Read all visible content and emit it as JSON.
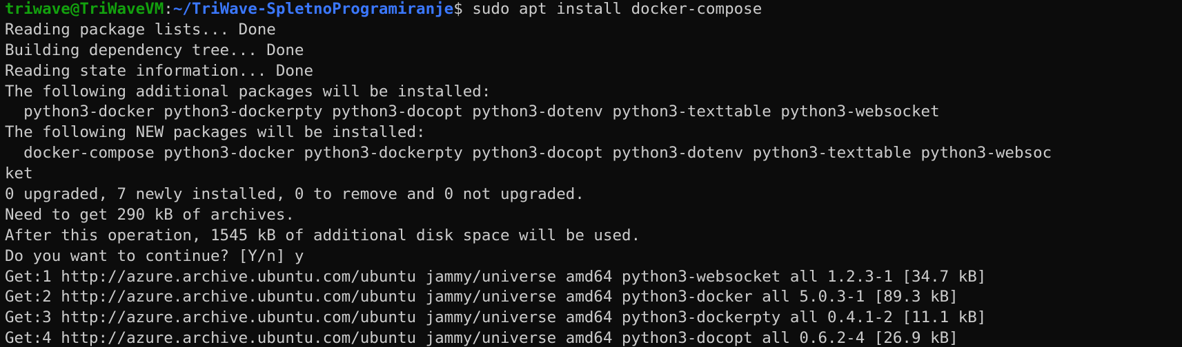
{
  "prompt": {
    "user_host": "triwave@TriWaveVM",
    "separator": ":",
    "path": "~/TriWave-SpletnoProgramiranje",
    "symbol": "$",
    "command": " sudo apt install docker-compose"
  },
  "colors": {
    "background": "#0c0c0c",
    "foreground": "#cccccc",
    "user_host": "#13a10e",
    "path": "#3b78ff"
  },
  "output": [
    "Reading package lists... Done",
    "Building dependency tree... Done",
    "Reading state information... Done",
    "The following additional packages will be installed:",
    "  python3-docker python3-dockerpty python3-docopt python3-dotenv python3-texttable python3-websocket",
    "The following NEW packages will be installed:",
    "  docker-compose python3-docker python3-dockerpty python3-docopt python3-dotenv python3-texttable python3-websoc",
    "ket",
    "0 upgraded, 7 newly installed, 0 to remove and 0 not upgraded.",
    "Need to get 290 kB of archives.",
    "After this operation, 1545 kB of additional disk space will be used.",
    "Do you want to continue? [Y/n] y",
    "Get:1 http://azure.archive.ubuntu.com/ubuntu jammy/universe amd64 python3-websocket all 1.2.3-1 [34.7 kB]",
    "Get:2 http://azure.archive.ubuntu.com/ubuntu jammy/universe amd64 python3-docker all 5.0.3-1 [89.3 kB]",
    "Get:3 http://azure.archive.ubuntu.com/ubuntu jammy/universe amd64 python3-dockerpty all 0.4.1-2 [11.1 kB]",
    "Get:4 http://azure.archive.ubuntu.com/ubuntu jammy/universe amd64 python3-docopt all 0.6.2-4 [26.9 kB]"
  ]
}
